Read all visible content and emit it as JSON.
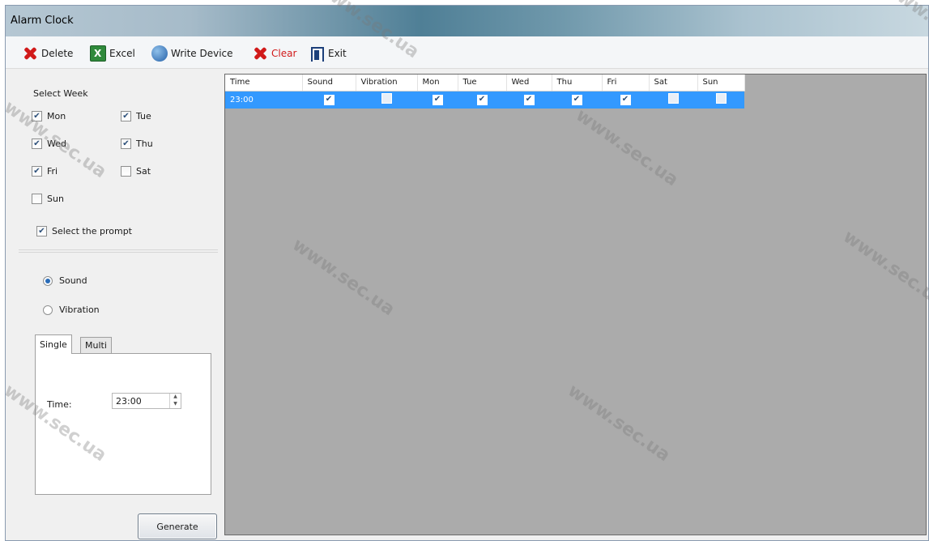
{
  "window": {
    "title": "Alarm Clock"
  },
  "toolbar": {
    "delete_label": "Delete",
    "excel_label": "Excel",
    "write_device_label": "Write Device",
    "clear_label": "Clear",
    "exit_label": "Exit"
  },
  "week": {
    "title": "Select Week",
    "days": [
      {
        "label": "Mon",
        "checked": true
      },
      {
        "label": "Tue",
        "checked": true
      },
      {
        "label": "Wed",
        "checked": true
      },
      {
        "label": "Thu",
        "checked": true
      },
      {
        "label": "Fri",
        "checked": true
      },
      {
        "label": "Sat",
        "checked": false
      },
      {
        "label": "Sun",
        "checked": false
      }
    ],
    "prompt_label": "Select the prompt",
    "prompt_checked": true
  },
  "mode": {
    "sound_label": "Sound",
    "vibration_label": "Vibration",
    "selected": "Sound"
  },
  "tabs": {
    "single_label": "Single",
    "multi_label": "Multi",
    "time_label": "Time:",
    "time_value": "23:00"
  },
  "generate_label": "Generate",
  "grid": {
    "columns": [
      "Time",
      "Sound",
      "Vibration",
      "Mon",
      "Tue",
      "Wed",
      "Thu",
      "Fri",
      "Sat",
      "Sun"
    ],
    "rows": [
      {
        "time": "23:00",
        "flags": [
          true,
          false,
          true,
          true,
          true,
          true,
          true,
          false,
          false
        ]
      }
    ]
  },
  "watermark": "www.sec.ua",
  "colors": {
    "selection": "#3399ff",
    "grid_bg": "#ababab",
    "clear_text": "#d11a1a"
  }
}
